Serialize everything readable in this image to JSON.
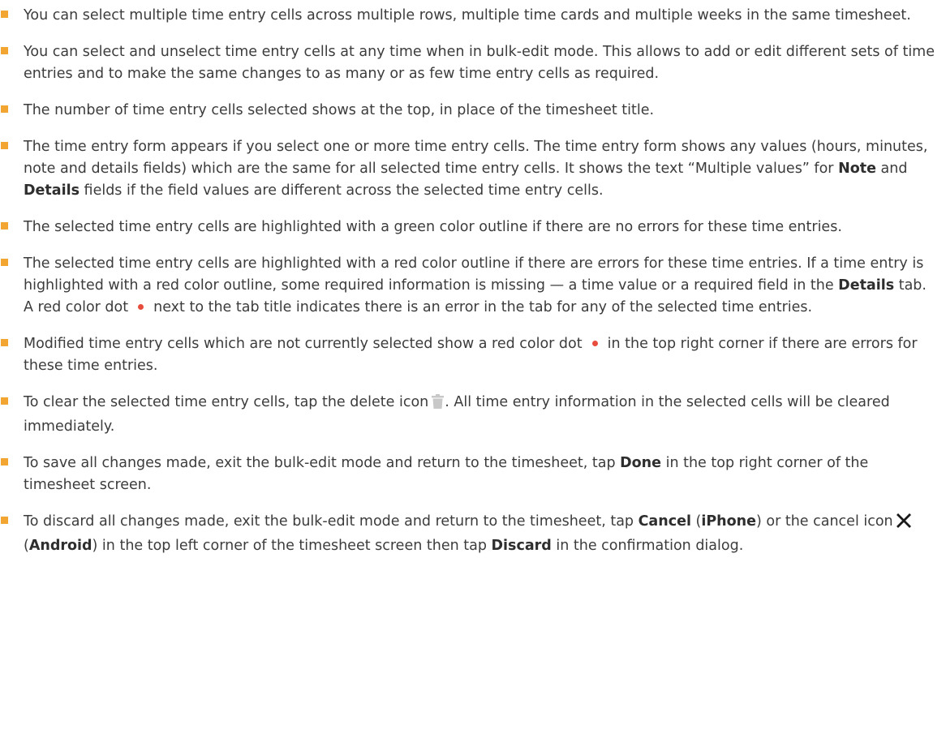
{
  "bullets": [
    {
      "text": "You can select multiple time entry cells across multiple rows, multiple time cards and multiple weeks in the same timesheet."
    },
    {
      "text": "You can select and unselect time entry cells at any time when in bulk-edit mode. This allows to add or edit different sets of time entries and to make the same changes to as many or as few time entry cells as required."
    },
    {
      "text": "The number of time entry cells selected shows at the top, in place of the timesheet title."
    },
    {
      "p1": "The time entry form appears if you select one or more time entry cells. The time entry form shows any values (hours, minutes, note and details fields) which are the same for all selected time entry cells. It shows the text “Multiple values” for ",
      "b1": "Note",
      "p2": " and ",
      "b2": "Details",
      "p3": " fields if the field values are different across the selected time entry cells."
    },
    {
      "text": "The selected time entry cells are highlighted with a green color outline if there are no errors for these time entries."
    },
    {
      "p1": "The selected time entry cells are highlighted with a red color outline if there are errors for these time entries. If a time entry is highlighted with a red color outline, some required information is missing — a time value or a required field in the ",
      "b1": "Details",
      "p2": " tab. A red color dot",
      "p3": "next to the tab title indicates there is an error in the tab for any of the selected time entries."
    },
    {
      "p1": "Modified time entry cells which are not currently selected show a red color dot",
      "p2": "in the top right corner if there are errors for these time entries."
    },
    {
      "p1": "To clear the selected time entry cells, tap the delete icon",
      "p2": ". All time entry information in the selected cells will be cleared immediately."
    },
    {
      "p1": "To save all changes made, exit the bulk-edit mode and return to the timesheet, tap ",
      "b1": "Done",
      "p2": " in the top right corner of the timesheet screen."
    },
    {
      "p1": "To discard all changes made, exit the bulk-edit mode and return to the timesheet, tap ",
      "b1": "Cancel",
      "p2": " (",
      "b2": "iPhone",
      "p3": ") or the cancel icon",
      "p4": " (",
      "b3": "Android",
      "p5": ") in the top left corner of the timesheet screen then tap ",
      "b4": "Discard",
      "p6": " in the confirmation dialog."
    }
  ],
  "colors": {
    "bullet": "#f2a531",
    "red_dot": "#e74c3c",
    "text": "#3c3c3c",
    "icon": "#c8c8c8"
  },
  "icons": {
    "delete": "delete-icon",
    "cancel": "cancel-x-icon"
  }
}
